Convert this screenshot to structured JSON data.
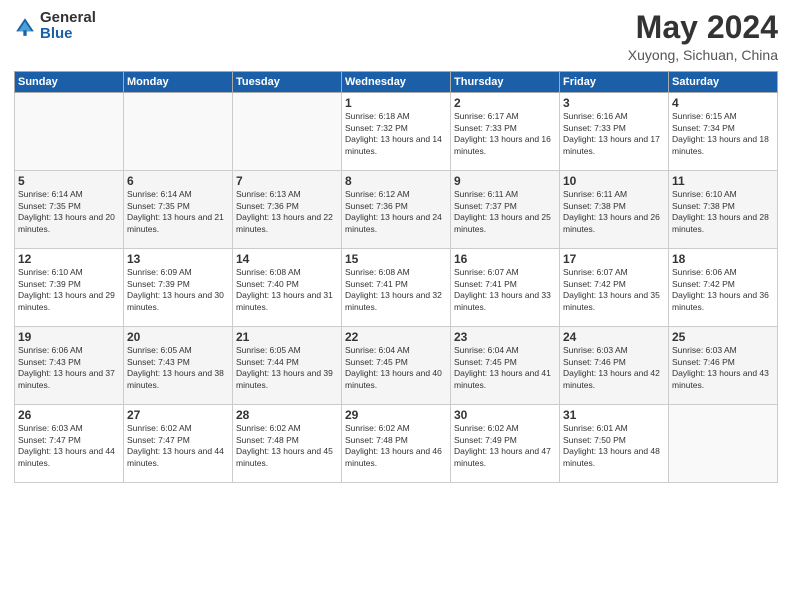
{
  "logo": {
    "general": "General",
    "blue": "Blue"
  },
  "title": "May 2024",
  "subtitle": "Xuyong, Sichuan, China",
  "days_of_week": [
    "Sunday",
    "Monday",
    "Tuesday",
    "Wednesday",
    "Thursday",
    "Friday",
    "Saturday"
  ],
  "weeks": [
    [
      {
        "day": "",
        "info": ""
      },
      {
        "day": "",
        "info": ""
      },
      {
        "day": "",
        "info": ""
      },
      {
        "day": "1",
        "info": "Sunrise: 6:18 AM\nSunset: 7:32 PM\nDaylight: 13 hours and 14 minutes."
      },
      {
        "day": "2",
        "info": "Sunrise: 6:17 AM\nSunset: 7:33 PM\nDaylight: 13 hours and 16 minutes."
      },
      {
        "day": "3",
        "info": "Sunrise: 6:16 AM\nSunset: 7:33 PM\nDaylight: 13 hours and 17 minutes."
      },
      {
        "day": "4",
        "info": "Sunrise: 6:15 AM\nSunset: 7:34 PM\nDaylight: 13 hours and 18 minutes."
      }
    ],
    [
      {
        "day": "5",
        "info": "Sunrise: 6:14 AM\nSunset: 7:35 PM\nDaylight: 13 hours and 20 minutes."
      },
      {
        "day": "6",
        "info": "Sunrise: 6:14 AM\nSunset: 7:35 PM\nDaylight: 13 hours and 21 minutes."
      },
      {
        "day": "7",
        "info": "Sunrise: 6:13 AM\nSunset: 7:36 PM\nDaylight: 13 hours and 22 minutes."
      },
      {
        "day": "8",
        "info": "Sunrise: 6:12 AM\nSunset: 7:36 PM\nDaylight: 13 hours and 24 minutes."
      },
      {
        "day": "9",
        "info": "Sunrise: 6:11 AM\nSunset: 7:37 PM\nDaylight: 13 hours and 25 minutes."
      },
      {
        "day": "10",
        "info": "Sunrise: 6:11 AM\nSunset: 7:38 PM\nDaylight: 13 hours and 26 minutes."
      },
      {
        "day": "11",
        "info": "Sunrise: 6:10 AM\nSunset: 7:38 PM\nDaylight: 13 hours and 28 minutes."
      }
    ],
    [
      {
        "day": "12",
        "info": "Sunrise: 6:10 AM\nSunset: 7:39 PM\nDaylight: 13 hours and 29 minutes."
      },
      {
        "day": "13",
        "info": "Sunrise: 6:09 AM\nSunset: 7:39 PM\nDaylight: 13 hours and 30 minutes."
      },
      {
        "day": "14",
        "info": "Sunrise: 6:08 AM\nSunset: 7:40 PM\nDaylight: 13 hours and 31 minutes."
      },
      {
        "day": "15",
        "info": "Sunrise: 6:08 AM\nSunset: 7:41 PM\nDaylight: 13 hours and 32 minutes."
      },
      {
        "day": "16",
        "info": "Sunrise: 6:07 AM\nSunset: 7:41 PM\nDaylight: 13 hours and 33 minutes."
      },
      {
        "day": "17",
        "info": "Sunrise: 6:07 AM\nSunset: 7:42 PM\nDaylight: 13 hours and 35 minutes."
      },
      {
        "day": "18",
        "info": "Sunrise: 6:06 AM\nSunset: 7:42 PM\nDaylight: 13 hours and 36 minutes."
      }
    ],
    [
      {
        "day": "19",
        "info": "Sunrise: 6:06 AM\nSunset: 7:43 PM\nDaylight: 13 hours and 37 minutes."
      },
      {
        "day": "20",
        "info": "Sunrise: 6:05 AM\nSunset: 7:43 PM\nDaylight: 13 hours and 38 minutes."
      },
      {
        "day": "21",
        "info": "Sunrise: 6:05 AM\nSunset: 7:44 PM\nDaylight: 13 hours and 39 minutes."
      },
      {
        "day": "22",
        "info": "Sunrise: 6:04 AM\nSunset: 7:45 PM\nDaylight: 13 hours and 40 minutes."
      },
      {
        "day": "23",
        "info": "Sunrise: 6:04 AM\nSunset: 7:45 PM\nDaylight: 13 hours and 41 minutes."
      },
      {
        "day": "24",
        "info": "Sunrise: 6:03 AM\nSunset: 7:46 PM\nDaylight: 13 hours and 42 minutes."
      },
      {
        "day": "25",
        "info": "Sunrise: 6:03 AM\nSunset: 7:46 PM\nDaylight: 13 hours and 43 minutes."
      }
    ],
    [
      {
        "day": "26",
        "info": "Sunrise: 6:03 AM\nSunset: 7:47 PM\nDaylight: 13 hours and 44 minutes."
      },
      {
        "day": "27",
        "info": "Sunrise: 6:02 AM\nSunset: 7:47 PM\nDaylight: 13 hours and 44 minutes."
      },
      {
        "day": "28",
        "info": "Sunrise: 6:02 AM\nSunset: 7:48 PM\nDaylight: 13 hours and 45 minutes."
      },
      {
        "day": "29",
        "info": "Sunrise: 6:02 AM\nSunset: 7:48 PM\nDaylight: 13 hours and 46 minutes."
      },
      {
        "day": "30",
        "info": "Sunrise: 6:02 AM\nSunset: 7:49 PM\nDaylight: 13 hours and 47 minutes."
      },
      {
        "day": "31",
        "info": "Sunrise: 6:01 AM\nSunset: 7:50 PM\nDaylight: 13 hours and 48 minutes."
      },
      {
        "day": "",
        "info": ""
      }
    ]
  ]
}
